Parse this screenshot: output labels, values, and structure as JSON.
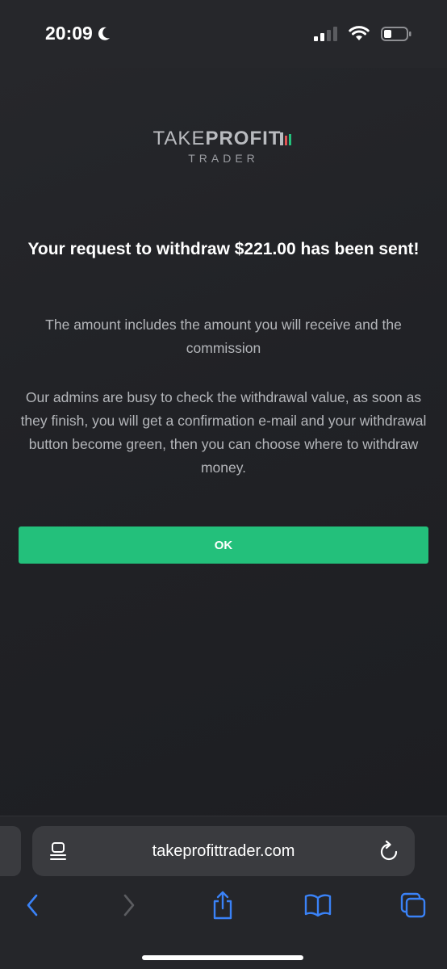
{
  "status_bar": {
    "time": "20:09"
  },
  "logo": {
    "take": "TAKE",
    "profit": "PROFIT",
    "trader": "TRADER"
  },
  "dialog": {
    "headline": "Your request to withdraw $221.00 has been sent!",
    "paragraph1": "The amount includes the amount you will receive and the commission",
    "paragraph2": "Our admins are busy to check the withdrawal value, as soon as they finish, you will get a confirmation e-mail and your withdrawal button become green, then you can choose where to withdraw money.",
    "ok_label": "OK"
  },
  "browser": {
    "address": "takeprofittrader.com"
  },
  "colors": {
    "accent_green": "#23c07b",
    "background": "#1c1d20",
    "link_blue": "#3a82f7"
  }
}
